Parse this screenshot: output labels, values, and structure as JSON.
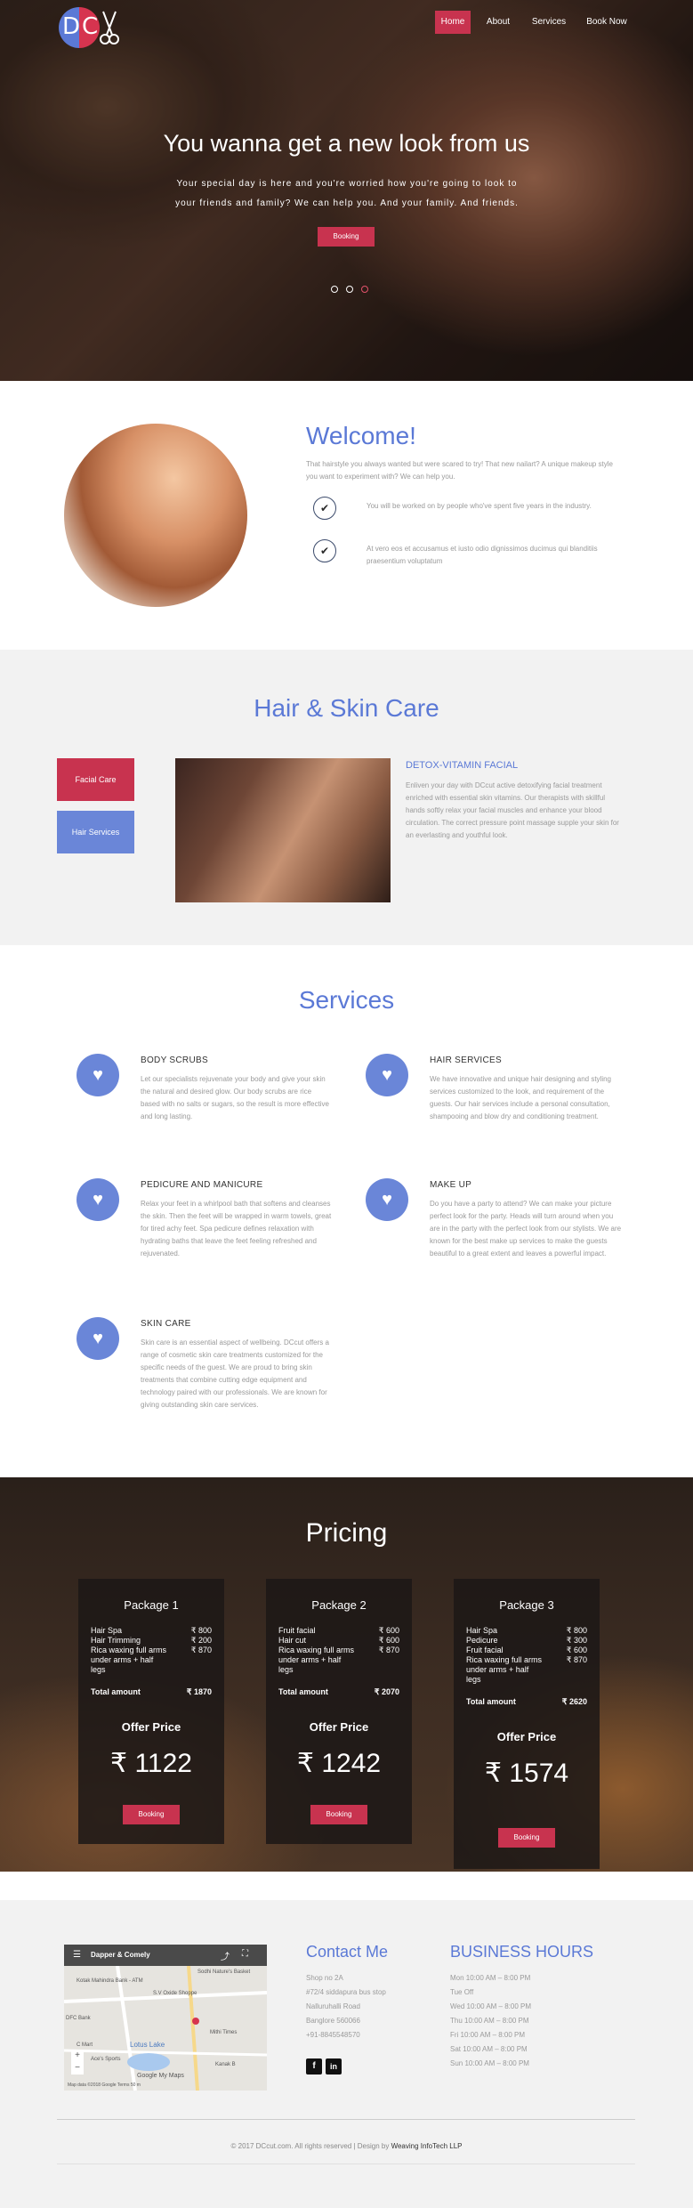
{
  "brand": {
    "letter1": "D",
    "letter2": "C"
  },
  "nav": {
    "home": "Home",
    "about": "About",
    "services": "Services",
    "book": "Book Now"
  },
  "hero": {
    "title": "You wanna get a new look from us",
    "subtitle_line1": "Your special day is here and you're worried how you're going to look to",
    "subtitle_line2": "your friends and family? We can help you. And your family. And friends.",
    "button": "Booking"
  },
  "welcome": {
    "title": "Welcome!",
    "intro": "That hairstyle you always wanted but were scared to try! That new nailart? A unique makeup style you want to experiment with? We can help you.",
    "point1": "You will be worked on by people who've spent five years in the industry.",
    "point2": "At vero eos et accusamus et iusto odio dignissimos ducimus qui blanditiis praesentium voluptatum"
  },
  "hair": {
    "title": "Hair & Skin Care",
    "tab1": "Facial Care",
    "tab2": "Hair Services",
    "feature_title": "DETOX-VITAMIN FACIAL",
    "feature_text": "Enliven your day with DCcut active detoxifying facial treatment enriched with essential skin vitamins. Our therapists with skillful hands softly relax your facial muscles and enhance your blood circulation. The correct pressure point massage supple your skin for an everlasting and youthful look."
  },
  "services": {
    "title": "Services",
    "items": [
      {
        "title": "BODY SCRUBS",
        "text": "Let our specialists rejuvenate your body and give your skin the natural and desired glow. Our body scrubs are rice based with no salts or sugars, so the result is more effective and long lasting."
      },
      {
        "title": "HAIR SERVICES",
        "text": "We have innovative and unique hair designing and styling services customized to the look, and requirement of the guests. Our hair services include a personal consultation, shampooing and blow dry and conditioning treatment."
      },
      {
        "title": "PEDICURE AND MANICURE",
        "text": "Relax your feet in a whirlpool bath that softens and cleanses the skin. Then the feet will be wrapped in warm towels, great for tired achy feet. Spa pedicure defines relaxation with hydrating baths that leave the feet feeling refreshed and rejuvenated."
      },
      {
        "title": "MAKE UP",
        "text": "Do you have a party to attend? We can make your picture perfect look for the party. Heads will turn around when you are in the party with the perfect look from our stylists. We are known for the best make up services to make the guests beautiful to a great extent and leaves a powerful impact."
      },
      {
        "title": "SKIN CARE",
        "text": "Skin care is an essential aspect of wellbeing. DCcut offers a range of cosmetic skin care treatments customized for the specific needs of the guest. We are proud to bring skin treatments that combine cutting edge equipment and technology paired with our professionals. We are known for giving outstanding skin care services."
      }
    ]
  },
  "pricing": {
    "title": "Pricing",
    "packages": [
      {
        "name": "Package 1",
        "items": [
          [
            "Hair Spa",
            "₹ 800"
          ],
          [
            "Hair Trimming",
            "₹ 200"
          ],
          [
            "Rica waxing full arms under arms + half legs",
            "₹ 870"
          ]
        ],
        "total_label": "Total amount",
        "total": "₹ 1870",
        "offer_label": "Offer Price",
        "offer": "₹ 1122",
        "button": "Booking"
      },
      {
        "name": "Package 2",
        "items": [
          [
            "Fruit facial",
            "₹ 600"
          ],
          [
            "Hair cut",
            "₹ 600"
          ],
          [
            "Rica waxing full arms under arms + half legs",
            "₹ 870"
          ]
        ],
        "total_label": "Total amount",
        "total": "₹ 2070",
        "offer_label": "Offer Price",
        "offer": "₹ 1242",
        "button": "Booking"
      },
      {
        "name": "Package 3",
        "items": [
          [
            "Hair Spa",
            "₹ 800"
          ],
          [
            "Pedicure",
            "₹ 300"
          ],
          [
            "Fruit facial",
            "₹ 600"
          ],
          [
            "Rica waxing full arms under arms + half legs",
            "₹ 870"
          ]
        ],
        "total_label": "Total amount",
        "total": "₹ 2620",
        "offer_label": "Offer Price",
        "offer": "₹ 1574",
        "button": "Booking"
      }
    ]
  },
  "footer": {
    "map": {
      "place": "Dapper & Comely",
      "labels": [
        "Sodhi Nature's Basket",
        "Kotak Mahindra Bank - ATM",
        "S.V Oxide Shoppe",
        "DFC Bank",
        "Mithi Times",
        "Lotus Lake",
        "Ace's Sports",
        "C Mart",
        "Kanak B"
      ],
      "brand": "Google My Maps",
      "footer_text": "Map data ©2018 Google   Terms   50 m"
    },
    "contact_title": "Contact Me",
    "contact_lines": [
      "Shop no 2A",
      "#72/4 siddapura bus stop",
      "Nalluruhalli Road",
      "Banglore 560066",
      "+91-8845548570"
    ],
    "hours_title": "BUSINESS HOURS",
    "hours": [
      "Mon 10:00 AM – 8:00 PM",
      "Tue Off",
      "Wed 10:00 AM – 8:00 PM",
      "Thu 10:00 AM – 8:00 PM",
      "Fri 10:00 AM – 8:00 PM",
      "Sat 10:00 AM – 8:00 PM",
      "Sun 10:00 AM – 8:00 PM"
    ],
    "copyright": "© 2017 DCcut.com. All rights reserved | Design by",
    "designer": "Weaving InfoTech LLP"
  }
}
